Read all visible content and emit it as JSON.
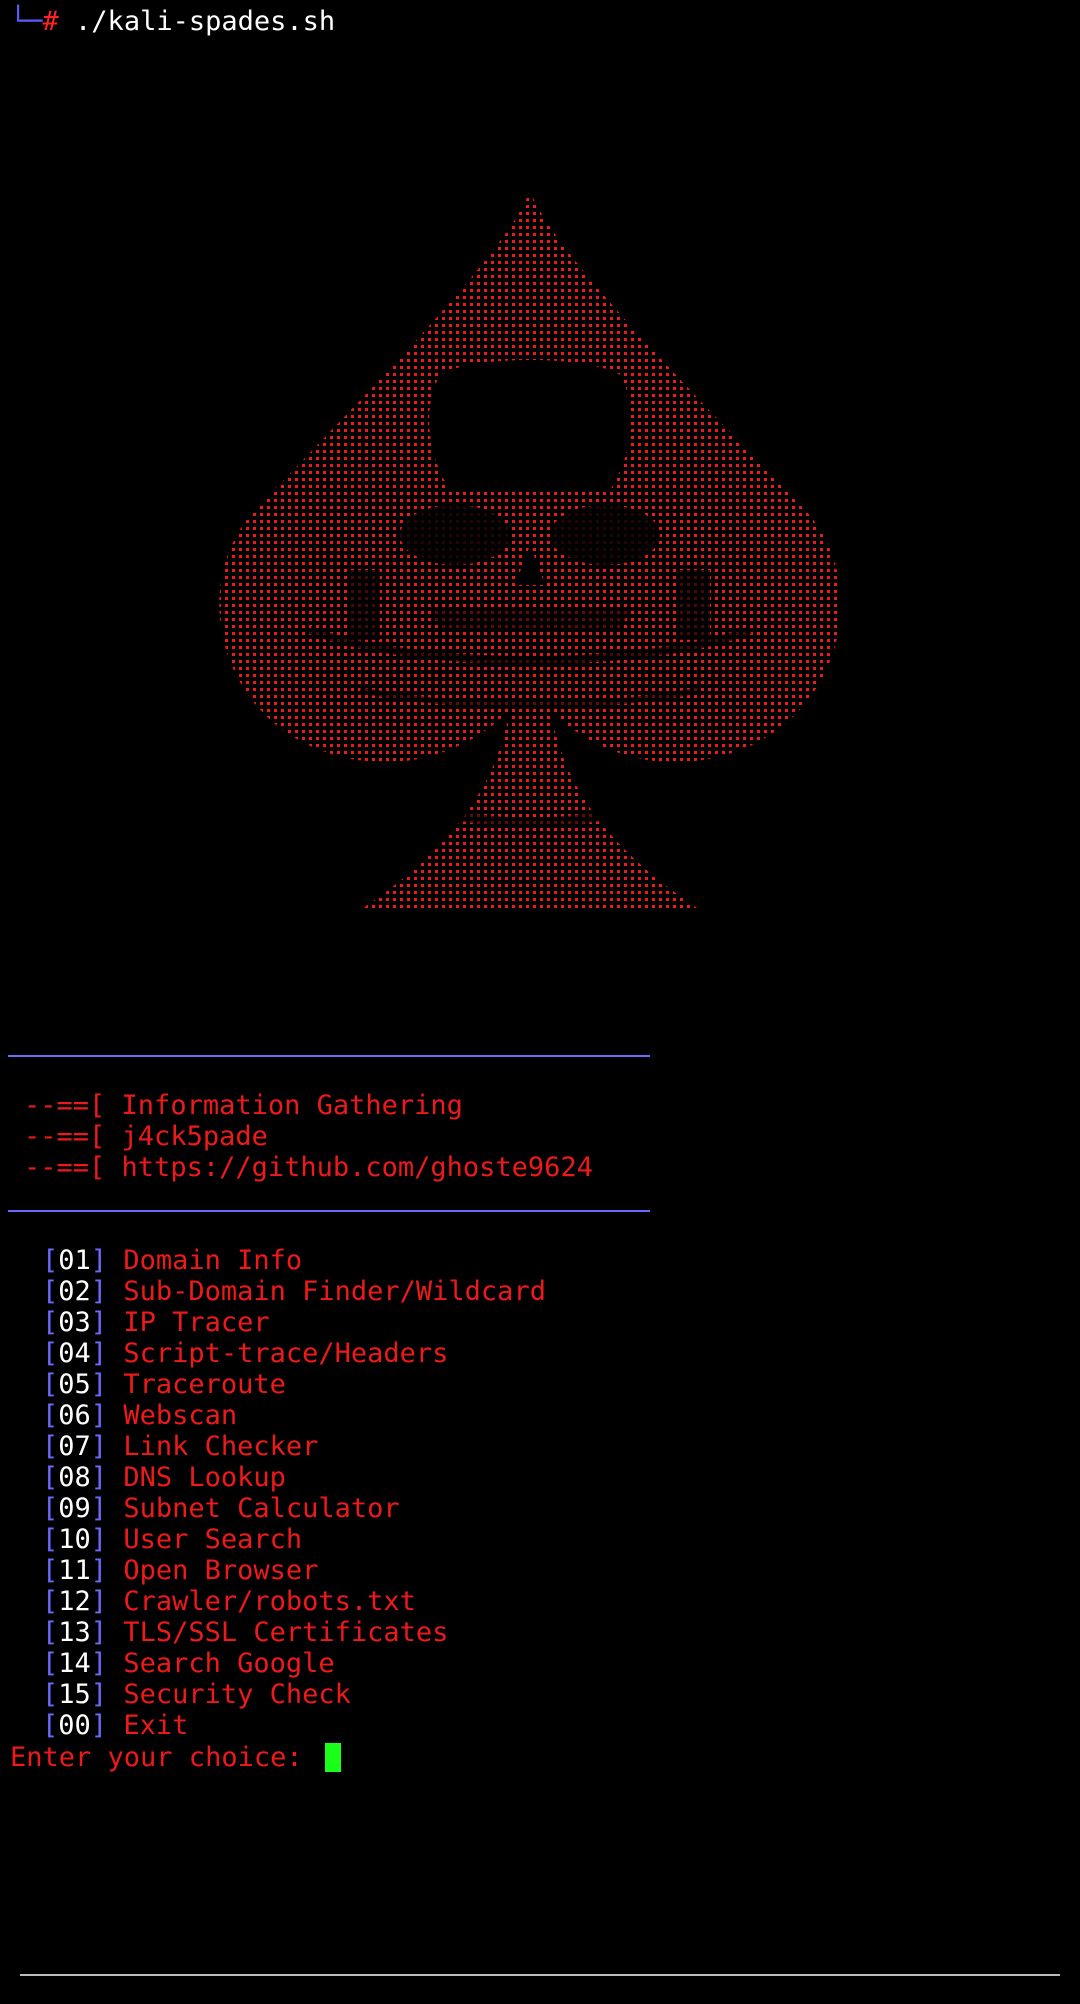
{
  "prompt": {
    "tree": "└─",
    "symbol": "#",
    "command": "./kali-spades.sh"
  },
  "banner": {
    "art": "ascii-spade-skull",
    "color": "#ee1a1a"
  },
  "info": [
    {
      "prefix": "--==[ ",
      "text": "Information Gathering"
    },
    {
      "prefix": "--==[ ",
      "text": "j4ck5pade"
    },
    {
      "prefix": "--==[ ",
      "text": "https://github.com/ghoste9624"
    }
  ],
  "menu": [
    {
      "num": "01",
      "label": "Domain Info"
    },
    {
      "num": "02",
      "label": "Sub-Domain Finder/Wildcard"
    },
    {
      "num": "03",
      "label": "IP Tracer"
    },
    {
      "num": "04",
      "label": "Script-trace/Headers"
    },
    {
      "num": "05",
      "label": "Traceroute"
    },
    {
      "num": "06",
      "label": "Webscan"
    },
    {
      "num": "07",
      "label": "Link Checker"
    },
    {
      "num": "08",
      "label": "DNS Lookup"
    },
    {
      "num": "09",
      "label": "Subnet Calculator"
    },
    {
      "num": "10",
      "label": "User Search"
    },
    {
      "num": "11",
      "label": "Open Browser"
    },
    {
      "num": "12",
      "label": "Crawler/robots.txt"
    },
    {
      "num": "13",
      "label": "TLS/SSL Certificates"
    },
    {
      "num": "14",
      "label": "Search Google"
    },
    {
      "num": "15",
      "label": "Security Check"
    },
    {
      "num": "00",
      "label": "Exit"
    }
  ],
  "input": {
    "label": "Enter your choice: "
  },
  "colors": {
    "background": "#000000",
    "red": "#ee1a1a",
    "blue": "#6a6aff",
    "cursor": "#1aff1a"
  }
}
